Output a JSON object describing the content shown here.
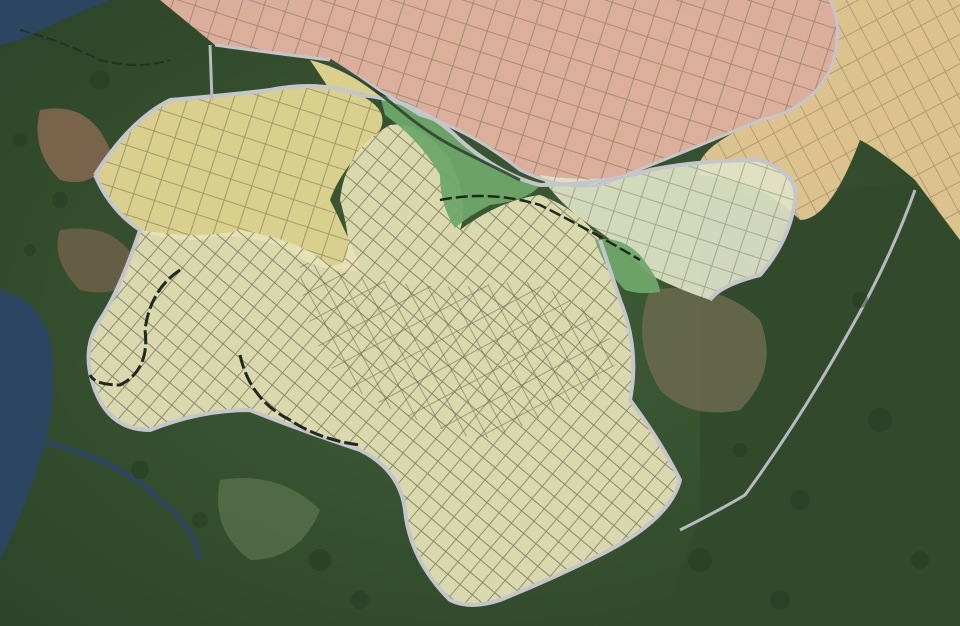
{
  "map": {
    "type": "satellite-zoning-map",
    "labels": [],
    "colors": {
      "forest_dark": "#2f4a2a",
      "forest_mid": "#3e5a34",
      "forest_light": "#56704a",
      "cleared_land": "#8a6a52",
      "water": "#2c4560",
      "zone_pink": "#e9b7a4",
      "zone_orange": "#f0cf98",
      "zone_yellow": "#ecde98",
      "zone_cream": "#e6e3b8",
      "zone_pale": "#dfe3c6",
      "zone_green": "#6ea86a",
      "street_lines": "#5e5a46",
      "boundary": "#c4c6cc",
      "stream_dashed": "#1e2a1e"
    },
    "zones": [
      {
        "id": "north-district",
        "color": "zone_pink"
      },
      {
        "id": "northeast-district",
        "color": "zone_orange"
      },
      {
        "id": "west-district",
        "color": "zone_yellow"
      },
      {
        "id": "central-district",
        "color": "zone_cream"
      },
      {
        "id": "east-district",
        "color": "zone_pale"
      },
      {
        "id": "green-corridor",
        "color": "zone_green"
      }
    ]
  }
}
